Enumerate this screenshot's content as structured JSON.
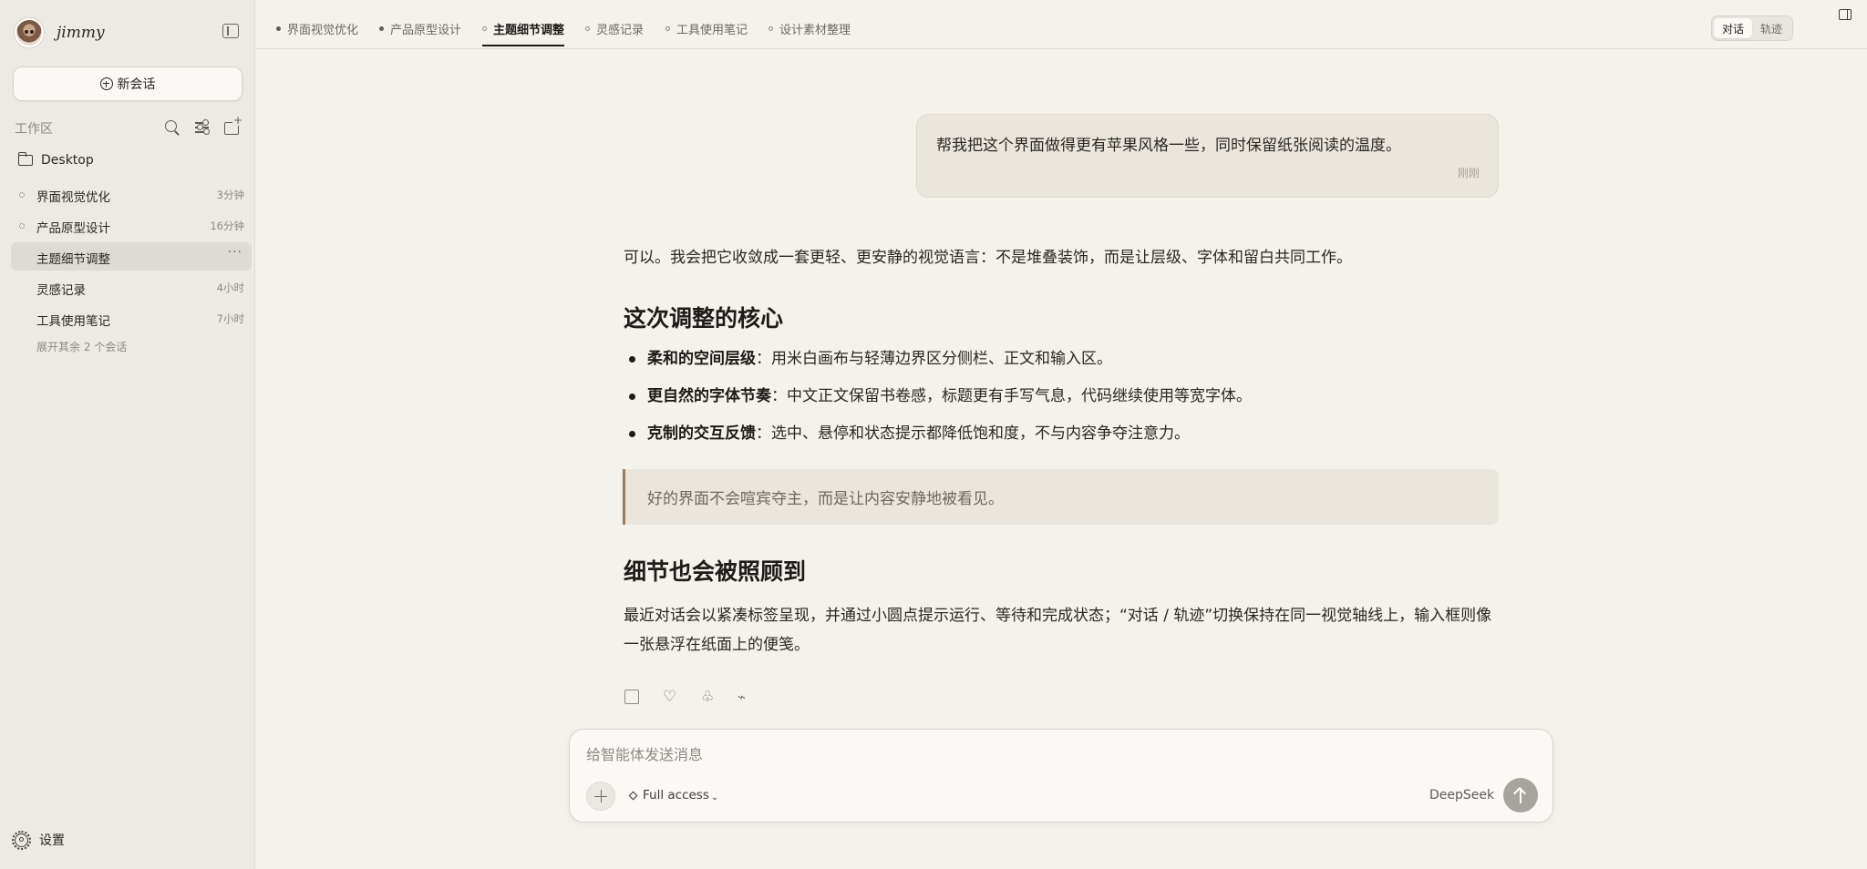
{
  "sidebar": {
    "user_name": "jimmy",
    "new_chat_label": "新会话",
    "workspace_label": "工作区",
    "folder_name": "Desktop",
    "conversations": [
      {
        "title": "界面视觉优化",
        "time": "3分钟"
      },
      {
        "title": "产品原型设计",
        "time": "16分钟"
      },
      {
        "title": "主题细节调整",
        "time": "",
        "more": "···"
      },
      {
        "title": "灵感记录",
        "time": "4小时"
      },
      {
        "title": "工具使用笔记",
        "time": "7小时"
      }
    ],
    "expand_more": "展开其余 2 个会话",
    "settings_label": "设置"
  },
  "tabs": [
    {
      "label": "界面视觉优化",
      "state": "running"
    },
    {
      "label": "产品原型设计",
      "state": "running"
    },
    {
      "label": "主题细节调整",
      "state": "active"
    },
    {
      "label": "灵感记录",
      "state": "idle"
    },
    {
      "label": "工具使用笔记",
      "state": "idle"
    },
    {
      "label": "设计素材整理",
      "state": "idle"
    }
  ],
  "view_toggle": {
    "chat": "对话",
    "trace": "轨迹",
    "selected": "对话"
  },
  "chat": {
    "user_message": "帮我把这个界面做得更有苹果风格一些，同时保留纸张阅读的温度。",
    "user_timestamp": "刚刚",
    "intro": "可以。我会把它收敛成一套更轻、更安静的视觉语言：不是堆叠装饰，而是让层级、字体和留白共同工作。",
    "heading1": "这次调整的核心",
    "bullets": [
      {
        "bold": "柔和的空间层级",
        "text": "：用米白画布与轻薄边界区分侧栏、正文和输入区。"
      },
      {
        "bold": "更自然的字体节奏",
        "text": "：中文正文保留书卷感，标题更有手写气息，代码继续使用等宽字体。"
      },
      {
        "bold": "克制的交互反馈",
        "text": "：选中、悬停和状态提示都降低饱和度，不与内容争夺注意力。"
      }
    ],
    "quote": "好的界面不会喧宾夺主，而是让内容安静地被看见。",
    "heading2": "细节也会被照顾到",
    "closing": "最近对话会以紧凑标签呈现，并通过小圆点提示运行、等待和完成状态；“对话 / 轨迹”切换保持在同一视觉轴线上，输入框则像一张悬浮在纸面上的便笺。"
  },
  "composer": {
    "placeholder": "给智能体发送消息",
    "value": "",
    "access_label": "Full access",
    "model": "DeepSeek"
  },
  "colors": {
    "accent_quote": "#9c7b5e",
    "canvas": "#f4f2ec",
    "sidebar": "#eceae4"
  }
}
